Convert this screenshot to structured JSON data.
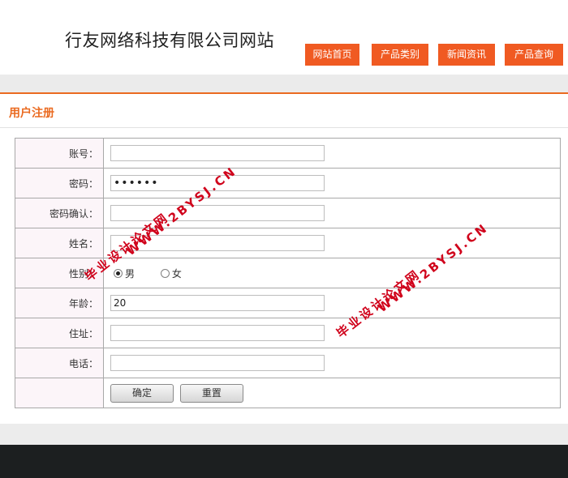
{
  "header": {
    "site_title": "行友网络科技有限公司网站",
    "nav": [
      "网站首页",
      "产品类别",
      "新闻资讯",
      "产品查询"
    ]
  },
  "section_title": "用户注册",
  "form": {
    "account_label": "账号：",
    "account_value": "",
    "password_label": "密码：",
    "password_value": "••••••",
    "confirm_label": "密码确认：",
    "confirm_value": "",
    "name_label": "姓名：",
    "name_value": "",
    "gender_label": "性别：",
    "gender_options": [
      "男",
      "女"
    ],
    "gender_selected": "男",
    "age_label": "年龄：",
    "age_value": "20",
    "address_label": "住址：",
    "address_value": "",
    "phone_label": "电话：",
    "phone_value": "",
    "submit_label": "确定",
    "reset_label": "重置"
  },
  "watermark": {
    "line1": "毕业设计论文网",
    "line2": "WWW.2BYSJ.CN"
  },
  "colors": {
    "accent": "#f05a22",
    "label_bg": "#fcf5f9",
    "footer": "#1c1f20"
  }
}
